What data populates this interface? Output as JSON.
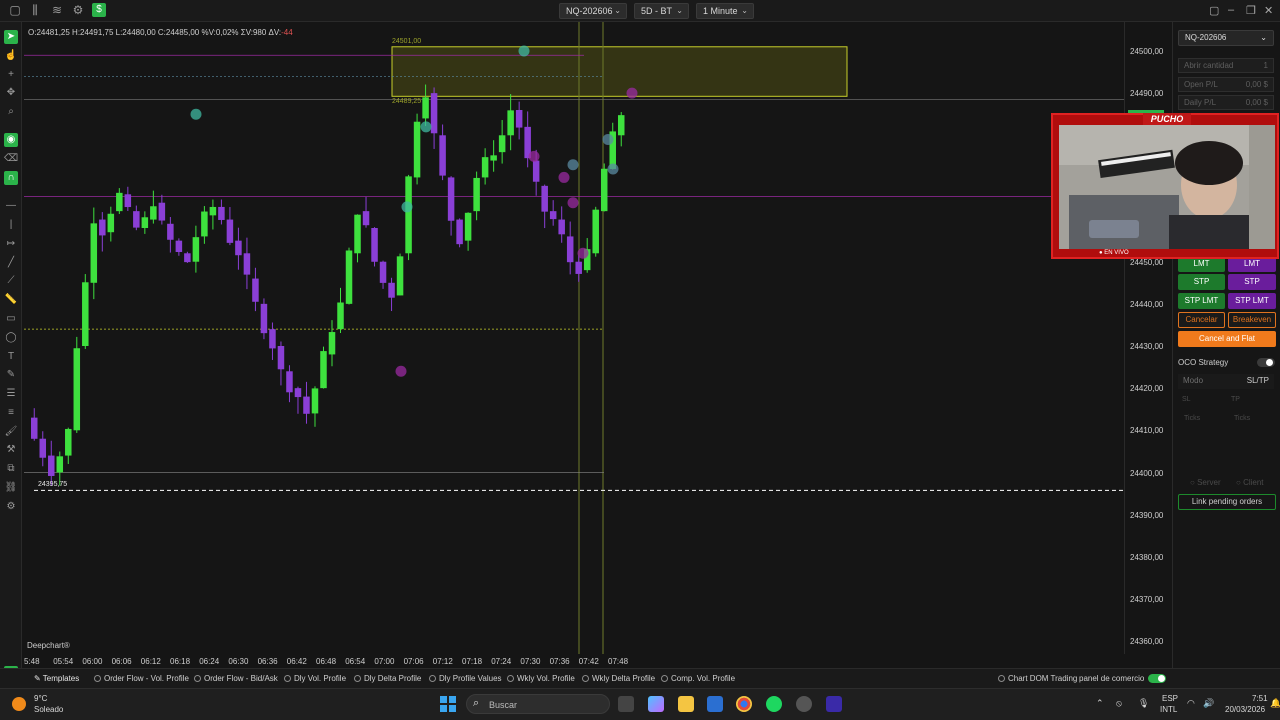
{
  "topbar": {
    "instrument": "NQ-202606",
    "timeframe_range": "5D - BT",
    "interval": "1 Minute"
  },
  "chart": {
    "ohlc": "O:24481,25  H:24491,75  L:24480,00  C:24485,00  %V:0,02%  ΣV:980  ΔV:",
    "delta_value": "-44",
    "watermark": "Deepchart®",
    "box_top_label": "24501,00",
    "box_bottom_label": "24489,25",
    "low_label": "24395,75",
    "y_labels": [
      "24500,00",
      "24490,00",
      "24480,00",
      "24470,00",
      "24460,00",
      "24450,00",
      "24440,00",
      "24430,00",
      "24420,00",
      "24410,00",
      "24400,00",
      "24390,00",
      "24380,00",
      "24370,00",
      "24360,00"
    ],
    "x_labels": [
      "5:48",
      "05:54",
      "06:00",
      "06:06",
      "06:12",
      "06:18",
      "06:24",
      "06:30",
      "06:36",
      "06:42",
      "06:48",
      "06:54",
      "07:00",
      "07:06",
      "07:12",
      "07:18",
      "07:24",
      "07:30",
      "07:36",
      "07:42",
      "07:48"
    ],
    "colors": {
      "up": "#3ee13e",
      "down": "#8a3fd6",
      "box": "#5a5a14",
      "dashed": "#ffffff"
    }
  },
  "right_panel": {
    "instrument": "NQ-202606",
    "open_qty_placeholder": "Abrir cantidad",
    "open_qty_value": "1",
    "open_pl_label": "Open P/L",
    "open_pl_value": "0,00 $",
    "daily_pl_label": "Daily P/L",
    "daily_pl_value": "0,00 $",
    "buy_lmt": "LMT",
    "sell_lmt": "LMT",
    "buy_stp": "STP",
    "sell_stp": "STP",
    "buy_stp_lmt": "STP LMT",
    "sell_stp_lmt": "STP LMT",
    "cancel": "Cancelar",
    "breakeven": "Breakeven",
    "cancel_flat": "Cancel and Flat",
    "oco_label": "OCO Strategy",
    "modo_label": "Modo",
    "modo_value": "SL/TP",
    "sl_label": "SL",
    "tp_label": "TP",
    "ticks_label_1": "Ticks",
    "ticks_label_2": "Ticks",
    "server_label": "Server",
    "client_label": "Client",
    "link_label": "Link pending orders"
  },
  "stream": {
    "name": "PUCHO",
    "live": "● EN VIVO"
  },
  "studies": {
    "templates": "Templates",
    "items": [
      "Order Flow - Vol. Profile",
      "Order Flow - Bid/Ask",
      "Dly Vol. Profile",
      "Dly Delta Profile",
      "Dly Profile Values",
      "Wkly Vol. Profile",
      "Wkly Delta Profile",
      "Comp. Vol. Profile"
    ],
    "chart_dom": "Chart DOM Trading",
    "panel": "panel de comercio"
  },
  "taskbar": {
    "weather_temp": "9°C",
    "weather_desc": "Soleado",
    "search_placeholder": "Buscar",
    "lang1": "ESP",
    "lang2": "INTL",
    "time": "7:51",
    "date": "20/03/2026"
  }
}
